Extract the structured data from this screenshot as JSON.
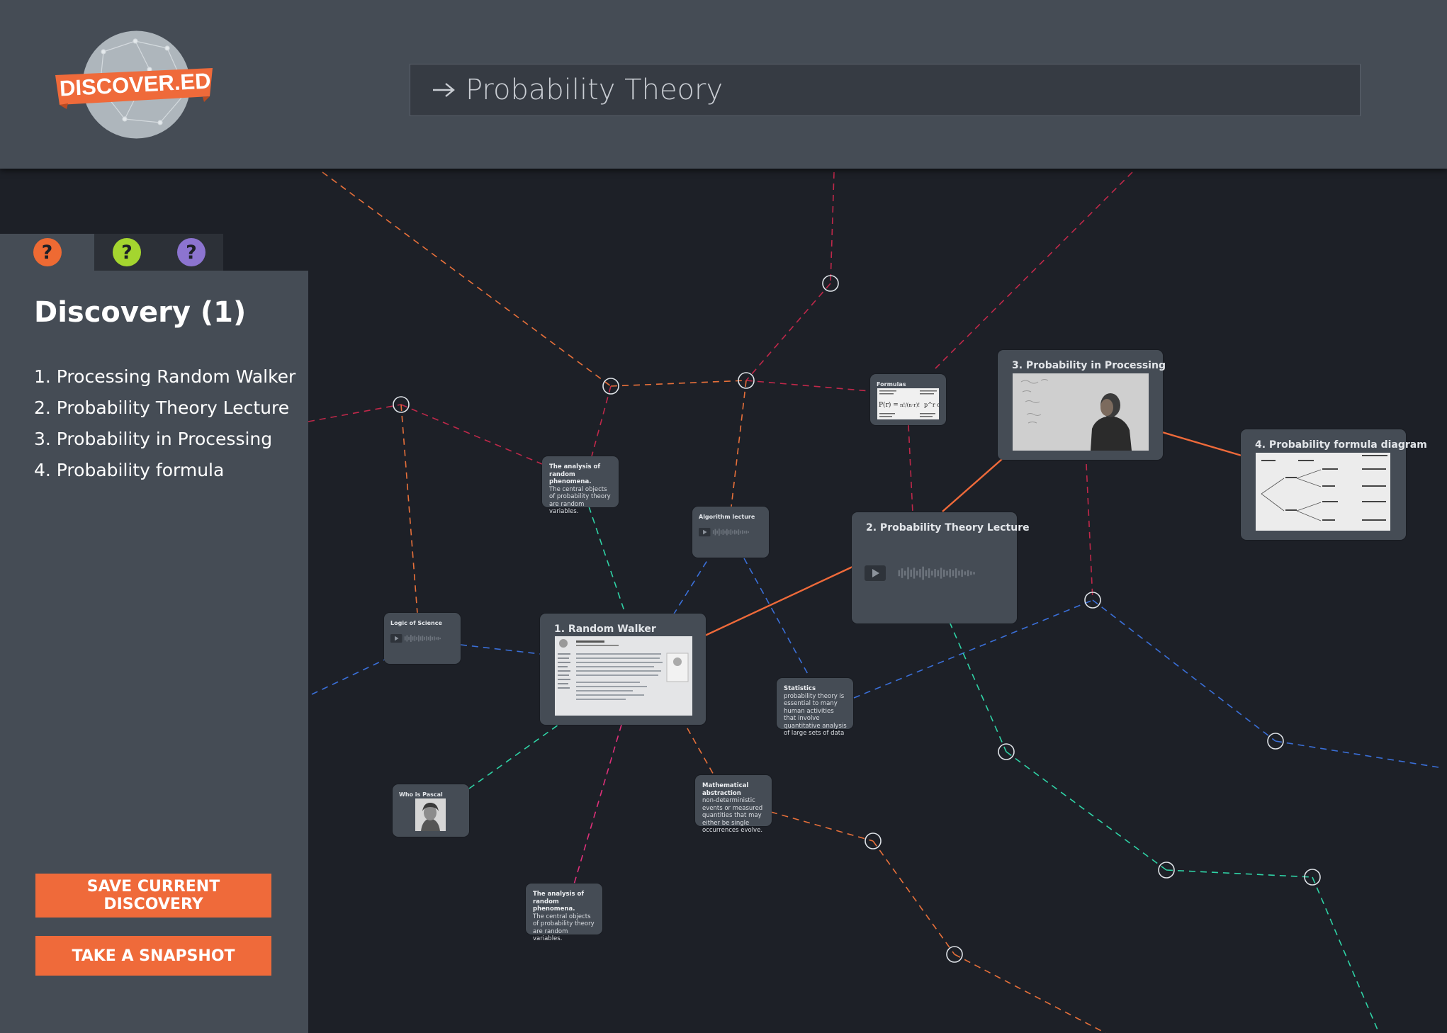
{
  "app": {
    "logo_text": "DISCOVER.ED"
  },
  "search": {
    "query": "Probability Theory"
  },
  "tabs": [
    {
      "icon": "question-icon",
      "color": "#ee6a33"
    },
    {
      "icon": "question-icon",
      "color": "#a4d52f"
    },
    {
      "icon": "question-icon",
      "color": "#8c74d0"
    }
  ],
  "panel": {
    "title": "Discovery (1)",
    "items": [
      "1. Processing Random Walker",
      "2. Probability Theory Lecture",
      "3. Probability in Processing",
      "4. Probability formula"
    ],
    "save_label": "Save current discovery",
    "snapshot_label": "Take a snapshot"
  },
  "cards": {
    "random_walker": {
      "title": "1. Random Walker"
    },
    "lecture": {
      "title": "2. Probability Theory Lecture"
    },
    "processing": {
      "title": "3. Probability in Processing"
    },
    "formula_diagram": {
      "title": "4. Probability formula diagram"
    },
    "formulas": {
      "title": "Formulas"
    },
    "algorithm_lecture": {
      "title": "Algorithm lecture"
    },
    "logic_of_science": {
      "title": "Logic of Science"
    },
    "who_is_pascal": {
      "title": "Who is Pascal"
    },
    "analysis_top": {
      "title": "The analysis of random phenomena.",
      "body": "The central objects of probability theory are random variables."
    },
    "analysis_bottom": {
      "title": "The analysis of random phenomena.",
      "body": "The central objects of probability theory are random variables."
    },
    "statistics": {
      "title": "Statistics",
      "body": "probability theory is essential to many human activities that involve quantitative analysis of large sets of data"
    },
    "math_abstraction": {
      "title": "Mathematical abstraction",
      "body": "non-deterministic events or measured quantities that may either be single occurrences evolve."
    }
  },
  "colors": {
    "accent": "#ef6a3a",
    "header_bg": "#454c55",
    "canvas_bg": "#1d2027",
    "edge_red": "#c0284a",
    "edge_orange": "#e8703a",
    "edge_blue": "#3a6fd8",
    "edge_teal": "#2fd3a6",
    "edge_pink": "#e0307a"
  }
}
